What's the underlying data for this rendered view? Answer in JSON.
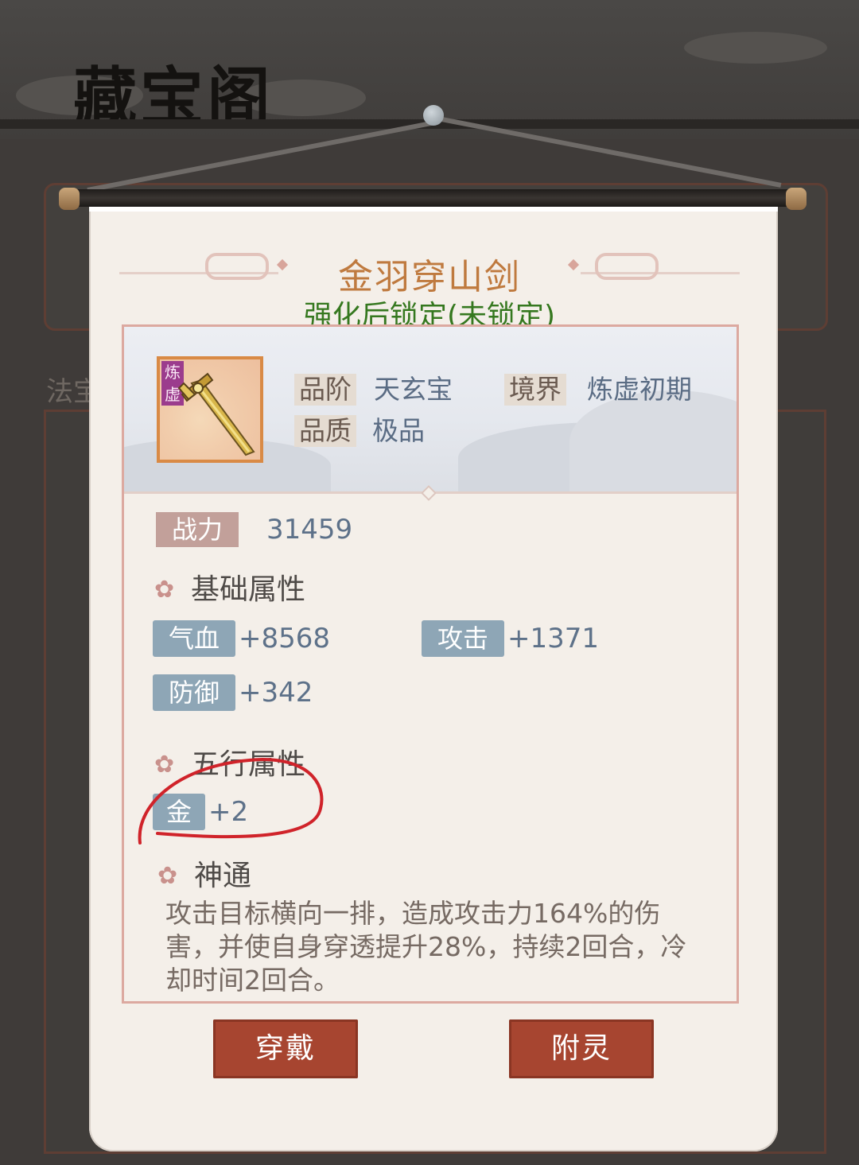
{
  "background": {
    "pavilion_title": "藏宝阁",
    "side_label": "法宝"
  },
  "item": {
    "name": "金羽穿山剑",
    "lock_status": "强化后锁定(未锁定)",
    "icon": "golden-sword-icon",
    "icon_tag": "炼虚",
    "grade_label": "品阶",
    "grade_value": "天玄宝",
    "realm_label": "境界",
    "realm_value": "炼虚初期",
    "quality_label": "品质",
    "quality_value": "极品"
  },
  "power": {
    "label": "战力",
    "value": "31459"
  },
  "basic_attributes": {
    "title": "基础属性",
    "stats": [
      {
        "label": "气血",
        "value": "+8568"
      },
      {
        "label": "攻击",
        "value": "+1371"
      },
      {
        "label": "防御",
        "value": "+342"
      }
    ]
  },
  "five_elements": {
    "title": "五行属性",
    "stats": [
      {
        "label": "金",
        "value": "+2"
      }
    ]
  },
  "skill": {
    "title": "神通",
    "description": "攻击目标横向一排，造成攻击力164%的伤害，并使自身穿透提升28%，持续2回合，冷却时间2回合。"
  },
  "buttons": {
    "equip": "穿戴",
    "enchant": "附灵"
  },
  "colors": {
    "item_name": "#bf7a3f",
    "lock_status": "#35781f",
    "button": "#a74530",
    "stat_tag": "#8ea6b6",
    "annotation_circle": "#d0232a"
  }
}
